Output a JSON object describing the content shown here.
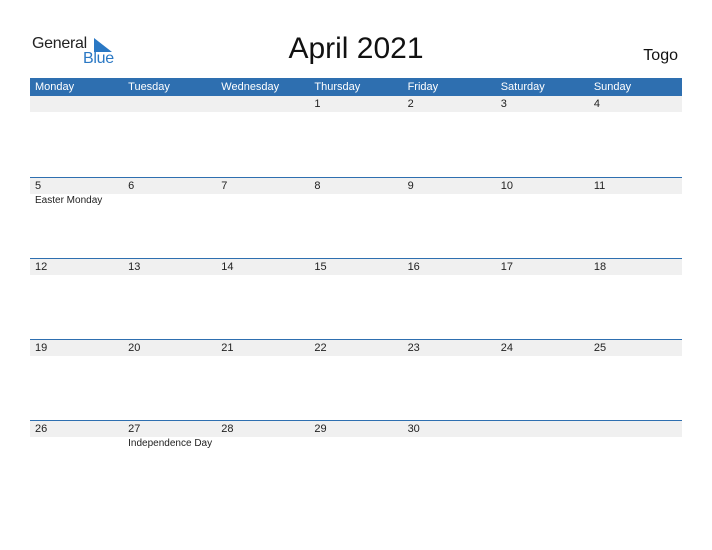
{
  "logo": {
    "part1": "General",
    "part2": "Blue"
  },
  "title": "April 2021",
  "country": "Togo",
  "weekdays": [
    "Monday",
    "Tuesday",
    "Wednesday",
    "Thursday",
    "Friday",
    "Saturday",
    "Sunday"
  ],
  "weeks": [
    {
      "days": [
        "",
        "",
        "",
        "1",
        "2",
        "3",
        "4"
      ],
      "events": [
        "",
        "",
        "",
        "",
        "",
        "",
        ""
      ]
    },
    {
      "days": [
        "5",
        "6",
        "7",
        "8",
        "9",
        "10",
        "11"
      ],
      "events": [
        "Easter Monday",
        "",
        "",
        "",
        "",
        "",
        ""
      ]
    },
    {
      "days": [
        "12",
        "13",
        "14",
        "15",
        "16",
        "17",
        "18"
      ],
      "events": [
        "",
        "",
        "",
        "",
        "",
        "",
        ""
      ]
    },
    {
      "days": [
        "19",
        "20",
        "21",
        "22",
        "23",
        "24",
        "25"
      ],
      "events": [
        "",
        "",
        "",
        "",
        "",
        "",
        ""
      ]
    },
    {
      "days": [
        "26",
        "27",
        "28",
        "29",
        "30",
        "",
        ""
      ],
      "events": [
        "",
        "Independence Day",
        "",
        "",
        "",
        "",
        ""
      ]
    }
  ]
}
